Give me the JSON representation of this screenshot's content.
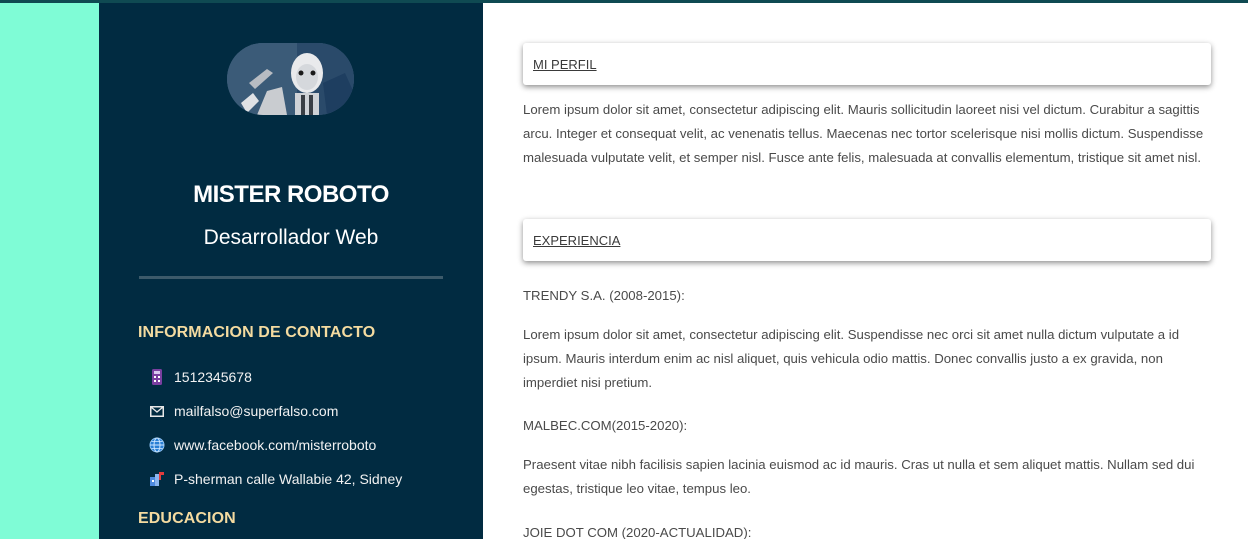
{
  "profile": {
    "name": "MISTER ROBOTO",
    "role": "Desarrollador Web"
  },
  "contact": {
    "title": "INFORMACION DE CONTACTO",
    "items": [
      {
        "icon": "phone-icon",
        "text": "1512345678"
      },
      {
        "icon": "mail-icon",
        "text": "mailfalso@superfalso.com"
      },
      {
        "icon": "globe-icon",
        "text": "www.facebook.com/misterroboto"
      },
      {
        "icon": "location-icon",
        "text": "P-sherman calle Wallabie 42, Sidney"
      }
    ]
  },
  "education": {
    "title": "EDUCACION"
  },
  "main": {
    "profile_title": "MI PERFIL",
    "profile_text": "Lorem ipsum dolor sit amet, consectetur adipiscing elit. Mauris sollicitudin laoreet nisi vel dictum. Curabitur a sagittis arcu. Integer et consequat velit, ac venenatis tellus. Maecenas nec tortor scelerisque nisi mollis dictum. Suspendisse malesuada vulputate velit, et semper nisl. Fusce ante felis, malesuada at convallis elementum, tristique sit amet nisl.",
    "experience_title": "EXPERIENCIA",
    "jobs": [
      {
        "title": "TRENDY S.A. (2008-2015):",
        "text": "Lorem ipsum dolor sit amet, consectetur adipiscing elit. Suspendisse nec orci sit amet nulla dictum vulputate a id ipsum. Mauris interdum enim ac nisl aliquet, quis vehicula odio mattis. Donec convallis justo a ex gravida, non imperdiet nisi pretium."
      },
      {
        "title": "MALBEC.COM(2015-2020):",
        "text": "Praesent vitae nibh facilisis sapien lacinia euismod ac id mauris. Cras ut nulla et sem aliquet mattis. Nullam sed dui egestas, tristique leo vitae, tempus leo."
      },
      {
        "title": "JOIE DOT COM (2020-ACTUALIDAD):"
      }
    ]
  },
  "colors": {
    "sidebar_bg": "#012b41",
    "page_bg": "#7ffcd6",
    "section_title": "#f4dba0"
  }
}
